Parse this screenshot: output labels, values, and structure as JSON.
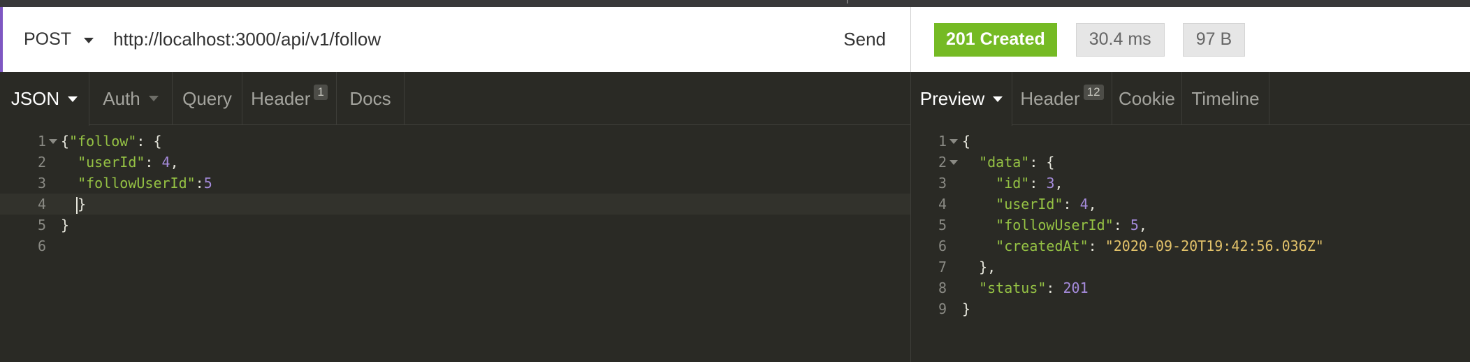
{
  "request": {
    "method": "POST",
    "url": "http://localhost:3000/api/v1/follow",
    "send_label": "Send"
  },
  "response": {
    "status": "201 Created",
    "time": "30.4 ms",
    "size": "97 B"
  },
  "request_tabs": {
    "json": "JSON",
    "auth": "Auth",
    "query": "Query",
    "header": "Header",
    "header_count": "1",
    "docs": "Docs"
  },
  "response_tabs": {
    "preview": "Preview",
    "header": "Header",
    "header_count": "12",
    "cookie": "Cookie",
    "timeline": "Timeline"
  },
  "request_body": {
    "line_numbers": [
      "1",
      "2",
      "3",
      "4",
      "5",
      "6"
    ],
    "l1_open": "{",
    "l1_key": "\"follow\"",
    "l1_colon": ": ",
    "l1_brace": "{",
    "l2_key": "\"userId\"",
    "l2_colon": ": ",
    "l2_val": "4",
    "l2_comma": ",",
    "l3_key": "\"followUserId\"",
    "l3_colon": ":",
    "l3_val": "5",
    "l4_close": "}",
    "l5_close": "}"
  },
  "response_body": {
    "line_numbers": [
      "1",
      "2",
      "3",
      "4",
      "5",
      "6",
      "7",
      "8",
      "9"
    ],
    "l1": "{",
    "l2_key": "\"data\"",
    "l2_rest": ": {",
    "l3_key": "\"id\"",
    "l3_colon": ": ",
    "l3_val": "3",
    "l3_comma": ",",
    "l4_key": "\"userId\"",
    "l4_colon": ": ",
    "l4_val": "4",
    "l4_comma": ",",
    "l5_key": "\"followUserId\"",
    "l5_colon": ": ",
    "l5_val": "5",
    "l5_comma": ",",
    "l6_key": "\"createdAt\"",
    "l6_colon": ": ",
    "l6_val": "\"2020-09-20T19:42:56.036Z\"",
    "l7": "},",
    "l8_key": "\"status\"",
    "l8_colon": ": ",
    "l8_val": "201",
    "l9": "}"
  },
  "colors": {
    "status_ok": "#75ba24",
    "accent": "#7e57c2",
    "json_key": "#95c244",
    "json_number": "#a58bdb",
    "json_string": "#e2c26a"
  }
}
